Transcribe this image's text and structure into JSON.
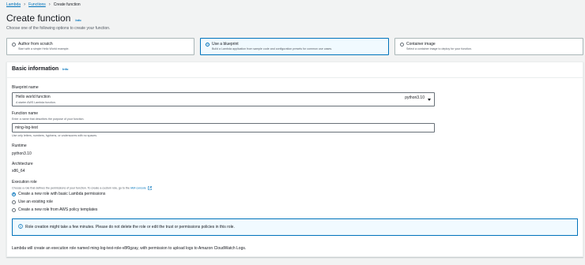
{
  "breadcrumb": {
    "root": "Lambda",
    "section": "Functions",
    "current": "Create function"
  },
  "page": {
    "title": "Create function",
    "info": "Info",
    "subtitle": "Choose one of the following options to create your function."
  },
  "options": [
    {
      "title": "Author from scratch",
      "desc": "Start with a simple Hello World example.",
      "selected": false
    },
    {
      "title": "Use a blueprint",
      "desc": "Build a Lambda application from sample code and configuration presets for common use cases.",
      "selected": true
    },
    {
      "title": "Container image",
      "desc": "Select a container image to deploy for your function.",
      "selected": false
    }
  ],
  "basic": {
    "title": "Basic information",
    "info": "Info",
    "blueprint_label": "Blueprint name",
    "blueprint_value": "Hello world function",
    "blueprint_sub": "A starter AWS Lambda function.",
    "blueprint_runtime": "python3.10",
    "fn_label": "Function name",
    "fn_desc": "Enter a name that describes the purpose of your function.",
    "fn_value": "ming-log-test",
    "fn_hint": "Use only letters, numbers, hyphens, or underscores with no spaces.",
    "runtime_label": "Runtime",
    "runtime_value": "python3.10",
    "arch_label": "Architecture",
    "arch_value": "x86_64",
    "role_label": "Execution role",
    "role_desc": "Choose a role that defines the permissions of your function. To create a custom role, go to the",
    "role_link": "IAM console",
    "role_options": [
      {
        "label": "Create a new role with basic Lambda permissions",
        "checked": true
      },
      {
        "label": "Use an existing role",
        "checked": false
      },
      {
        "label": "Create a new role from AWS policy templates",
        "checked": false
      }
    ],
    "alert": "Role creation might take a few minutes. Please do not delete the role or edit the trust or permissions policies in this role.",
    "footer": "Lambda will create an execution role named ming-log-test-role-v8f0gzay, with permission to upload logs to Amazon CloudWatch Logs."
  },
  "colors": {
    "accent": "#0073bb",
    "text": "#16191f",
    "muted": "#545b64",
    "background": "#f2f3f3"
  }
}
